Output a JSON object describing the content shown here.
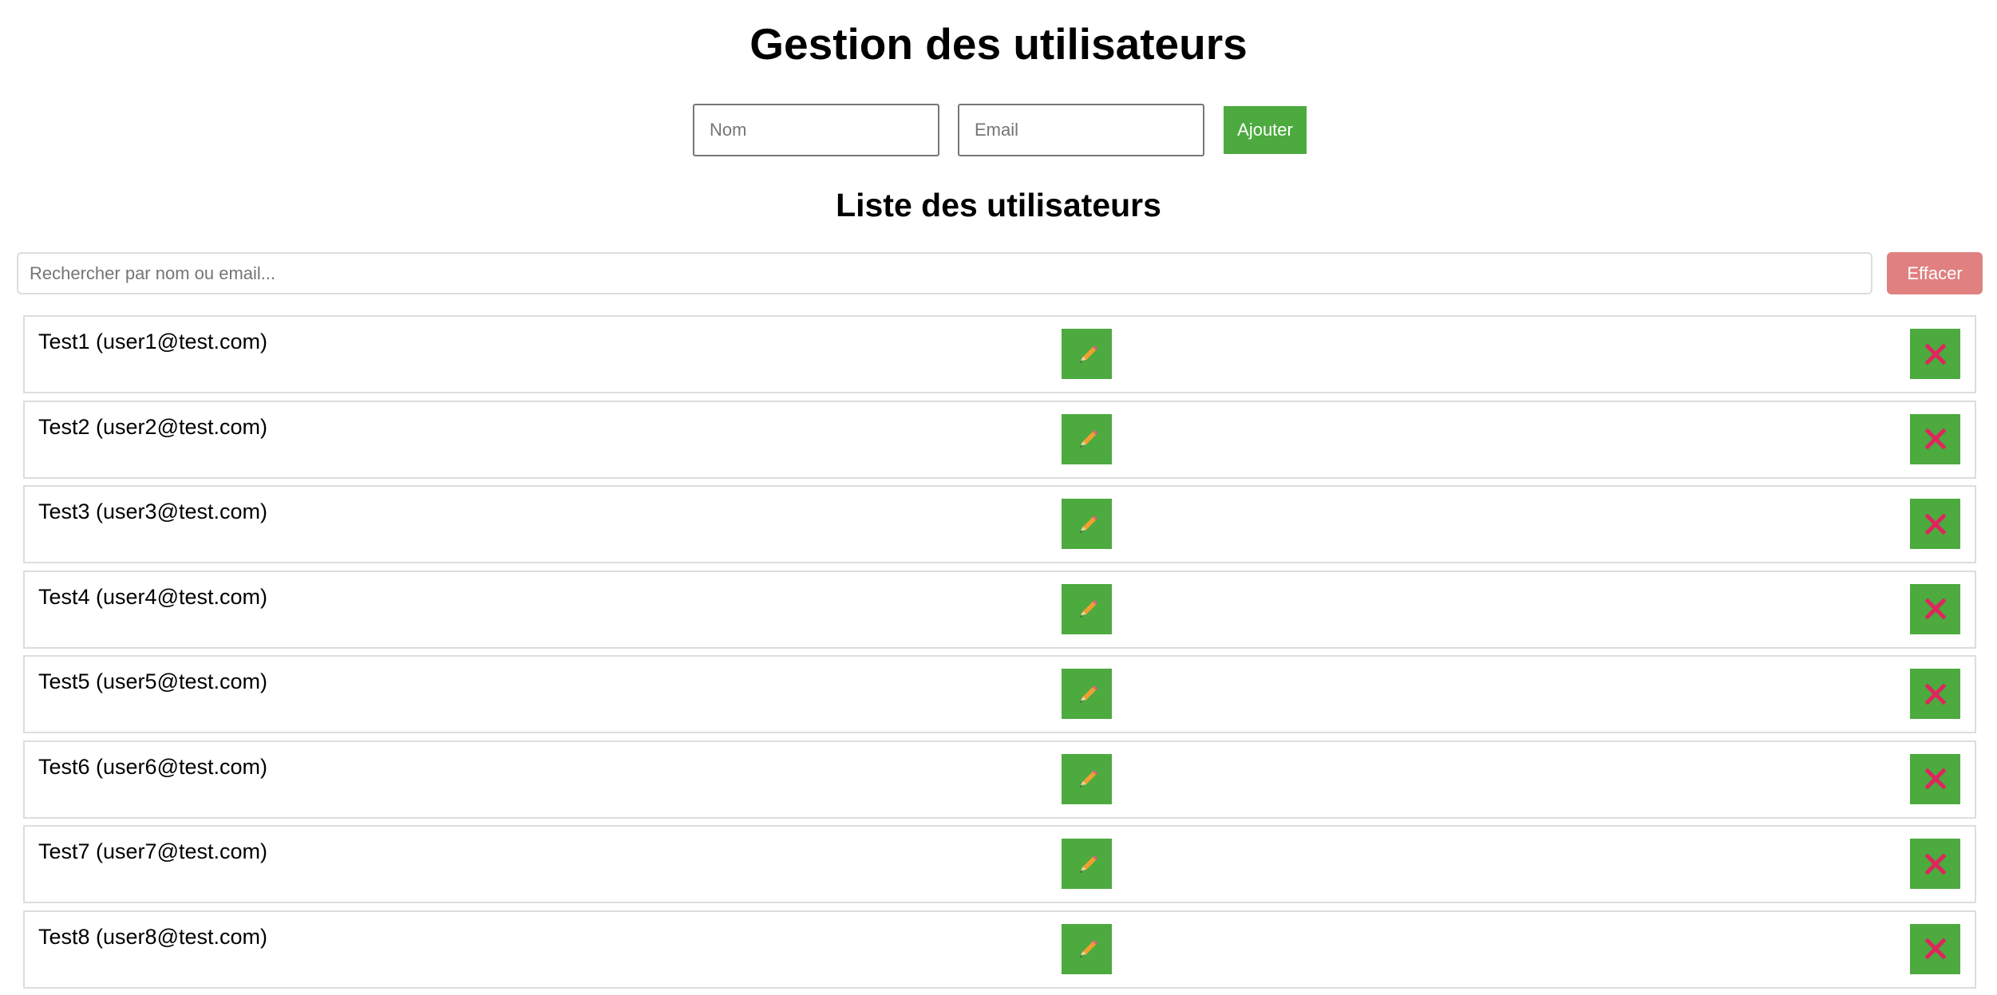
{
  "header": {
    "title": "Gestion des utilisateurs"
  },
  "add_form": {
    "name_placeholder": "Nom",
    "email_placeholder": "Email",
    "name_value": "",
    "email_value": "",
    "add_label": "Ajouter"
  },
  "list": {
    "title": "Liste des utilisateurs",
    "search_placeholder": "Rechercher par nom ou email...",
    "search_value": "",
    "clear_label": "Effacer",
    "edit_icon": "pencil-icon",
    "delete_icon": "close-icon",
    "users": [
      {
        "text": "Test1 (user1@test.com)"
      },
      {
        "text": "Test2 (user2@test.com)"
      },
      {
        "text": "Test3 (user3@test.com)"
      },
      {
        "text": "Test4 (user4@test.com)"
      },
      {
        "text": "Test5 (user5@test.com)"
      },
      {
        "text": "Test6 (user6@test.com)"
      },
      {
        "text": "Test7 (user7@test.com)"
      },
      {
        "text": "Test8 (user8@test.com)"
      }
    ]
  },
  "colors": {
    "button_green": "#4caa3f",
    "clear_button": "#e08080",
    "delete_cross": "#e0245e",
    "pencil": "#f0a030"
  }
}
